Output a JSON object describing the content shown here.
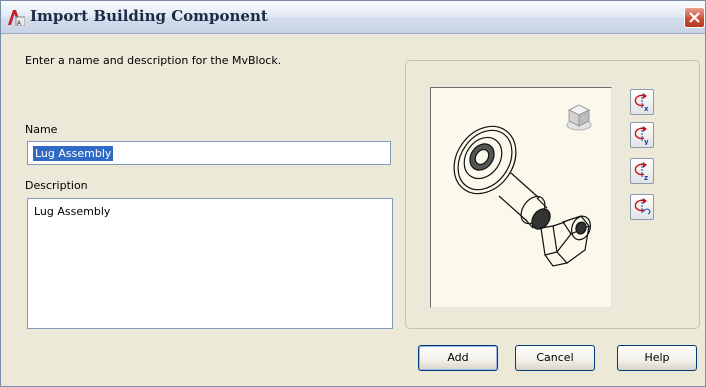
{
  "window": {
    "title": "Import Building Component",
    "close_icon": "close-icon"
  },
  "form": {
    "instruction": "Enter a name and description for the MvBlock.",
    "name_label": "Name",
    "name_value": "Lug Assembly",
    "description_label": "Description",
    "description_value": "Lug Assembly"
  },
  "preview": {
    "background_color": "#fbf9ec",
    "orbit_buttons": [
      "orbit-x-icon",
      "orbit-y-icon",
      "orbit-z-icon",
      "orbit-free-icon"
    ]
  },
  "buttons": {
    "add": "Add",
    "cancel": "Cancel",
    "help": "Help"
  },
  "colors": {
    "close_button": "#c94a32",
    "selection": "#316ac5",
    "icon_red": "#d01010",
    "icon_blue": "#1a3fae"
  }
}
